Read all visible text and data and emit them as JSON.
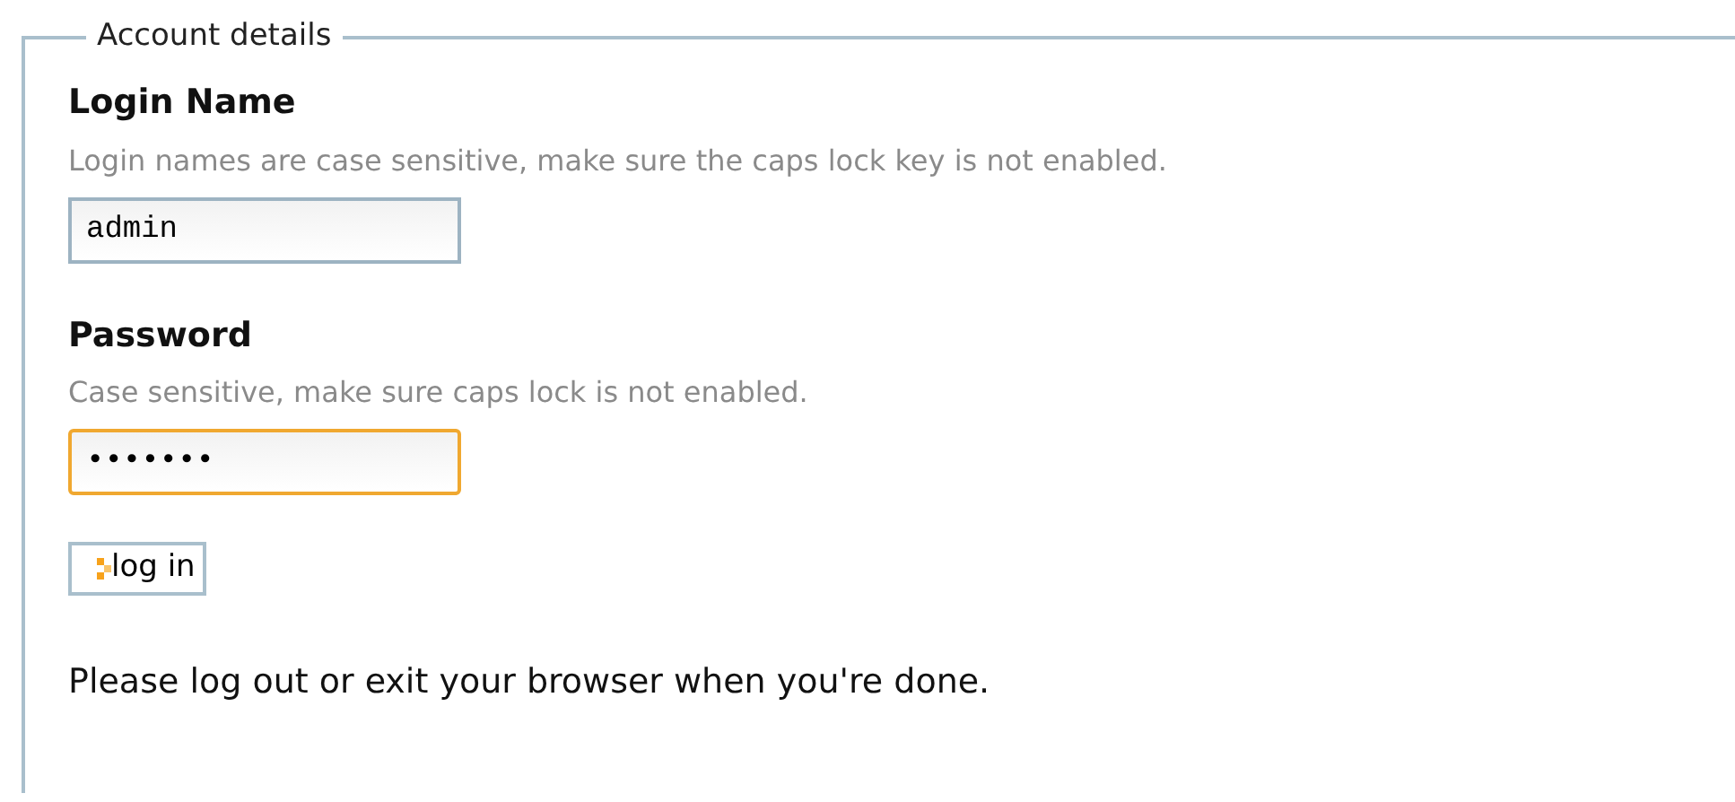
{
  "fieldset": {
    "legend": "Account details",
    "fields": [
      {
        "label": "Login Name",
        "hint": "Login names are case sensitive, make sure the caps lock key is not enabled.",
        "value": "admin",
        "focused": false
      },
      {
        "label": "Password",
        "hint": "Case sensitive, make sure caps lock is not enabled.",
        "value": "•••••••",
        "focused": true
      }
    ],
    "button": "log in",
    "note": "Please log out or exit your browser when you're done."
  }
}
